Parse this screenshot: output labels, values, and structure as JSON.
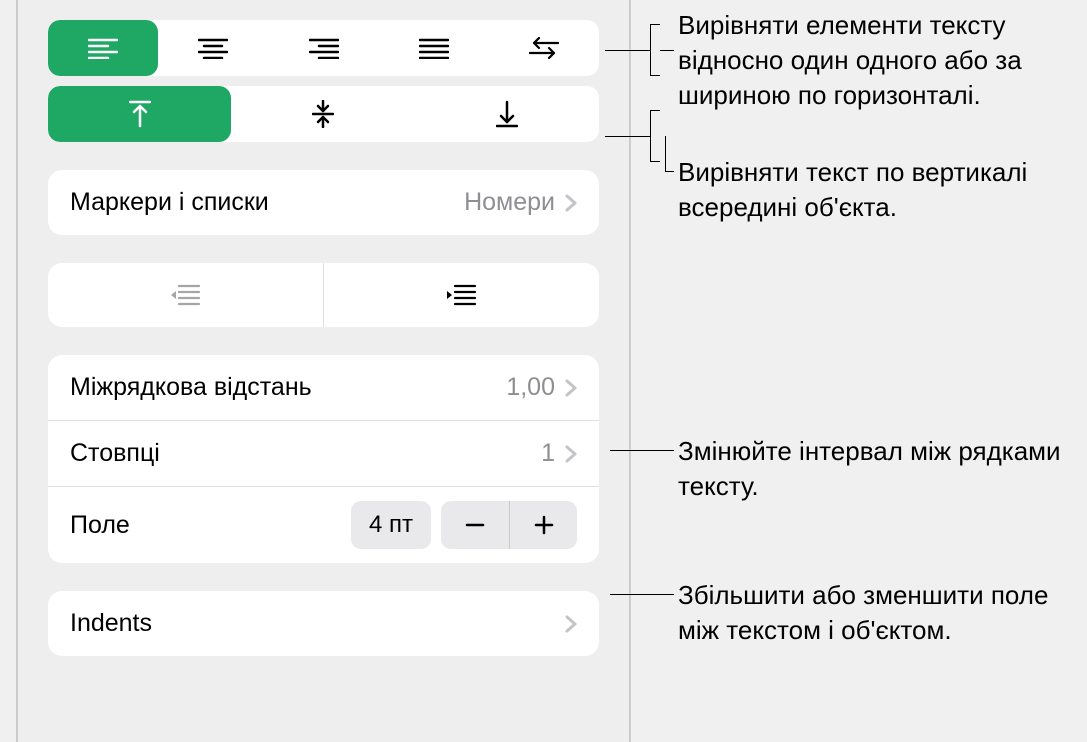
{
  "alignment": {
    "horizontal_selected": 0,
    "vertical_selected": 0
  },
  "bullets": {
    "label": "Маркери і списки",
    "value": "Номери"
  },
  "line_spacing": {
    "label": "Міжрядкова відстань",
    "value": "1,00"
  },
  "columns": {
    "label": "Стовпці",
    "value": "1"
  },
  "margin": {
    "label": "Поле",
    "value": "4 пт"
  },
  "indents": {
    "label": "Indents"
  },
  "annotations": {
    "horiz_align": "Вирівняти елементи тексту відносно один одного або за шириною по горизонталі.",
    "vert_align": "Вирівняти текст по вертикалі всередині об'єкта.",
    "line_spacing": "Змінюйте інтервал між рядками тексту.",
    "margin": "Збільшити або зменшити поле між текстом і об'єктом."
  }
}
